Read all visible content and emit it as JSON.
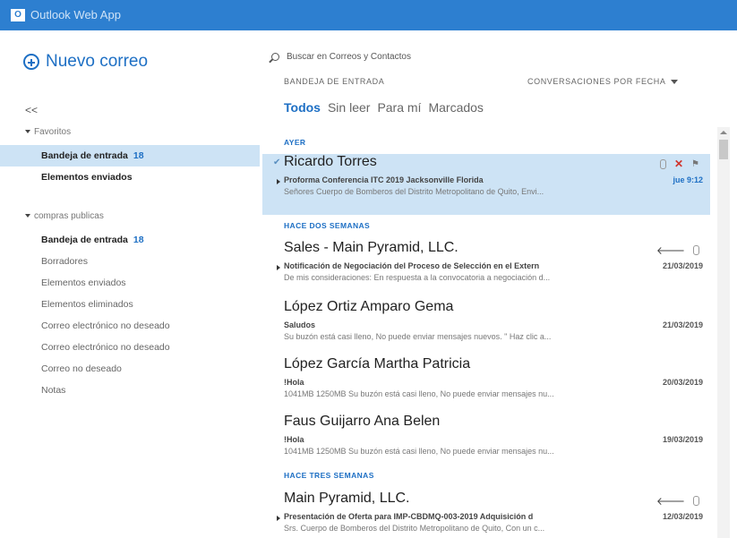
{
  "app": {
    "logo_letter": "O",
    "title": "Outlook Web App"
  },
  "left": {
    "new_mail": "Nuevo correo",
    "collapse": "<<",
    "favorites": {
      "label": "Favoritos",
      "items": [
        {
          "label": "Bandeja de entrada",
          "count": "18"
        },
        {
          "label": "Elementos enviados"
        }
      ]
    },
    "account": {
      "label": "compras publicas",
      "items": [
        {
          "label": "Bandeja de entrada",
          "count": "18"
        },
        {
          "label": "Borradores"
        },
        {
          "label": "Elementos enviados"
        },
        {
          "label": "Elementos eliminados"
        },
        {
          "label": "Correo electrónico no deseado"
        },
        {
          "label": "Correo electrónico no deseado"
        },
        {
          "label": "Correo no deseado"
        },
        {
          "label": "Notas"
        }
      ]
    }
  },
  "main": {
    "search_placeholder": "Buscar en Correos y Contactos",
    "folder_header": "BANDEJA DE ENTRADA",
    "sort_label": "CONVERSACIONES POR FECHA",
    "filters": [
      "Todos",
      "Sin leer",
      "Para mí",
      "Marcados"
    ],
    "sections": [
      "AYER",
      "HACE DOS SEMANAS",
      "HACE TRES SEMANAS"
    ],
    "messages": [
      {
        "from": "Ricardo Torres",
        "subject": "Proforma Conferencia ITC 2019 Jacksonville Florida",
        "preview": "Señores Cuerpo de Bomberos del Distrito Metropolitano de Quito, Envi...",
        "date": "jue 9:12"
      },
      {
        "from": "Sales - Main Pyramid, LLC.",
        "subject": "Notificación de Negociación del Proceso de Selección en el Extern",
        "preview": "De mis consideraciones: En respuesta a la convocatoria a negociación d...",
        "date": "21/03/2019"
      },
      {
        "from": "López Ortiz Amparo Gema",
        "subject": "Saludos",
        "preview": "Su buzón está casi lleno, No puede enviar mensajes nuevos. \" Haz clic a...",
        "date": "21/03/2019"
      },
      {
        "from": "López García Martha Patricia",
        "subject": "!Hola",
        "preview": "1041MB 1250MB Su buzón está casi lleno, No puede enviar mensajes nu...",
        "date": "20/03/2019"
      },
      {
        "from": "Faus Guijarro Ana Belen",
        "subject": "!Hola",
        "preview": "1041MB 1250MB Su buzón está casi lleno, No puede enviar mensajes nu...",
        "date": "19/03/2019"
      },
      {
        "from": "Main Pyramid, LLC.",
        "subject": "Presentación de Oferta para IMP-CBDMQ-003-2019 Adquisición d",
        "preview": "Srs. Cuerpo de Bomberos del Distrito Metropolitano de Quito, Con un c...",
        "date": "12/03/2019"
      }
    ]
  },
  "colors": {
    "topbar": "#2d7fd0",
    "accent": "#1d6fc4",
    "selected": "#cde3f5",
    "delete": "#d0342c"
  }
}
